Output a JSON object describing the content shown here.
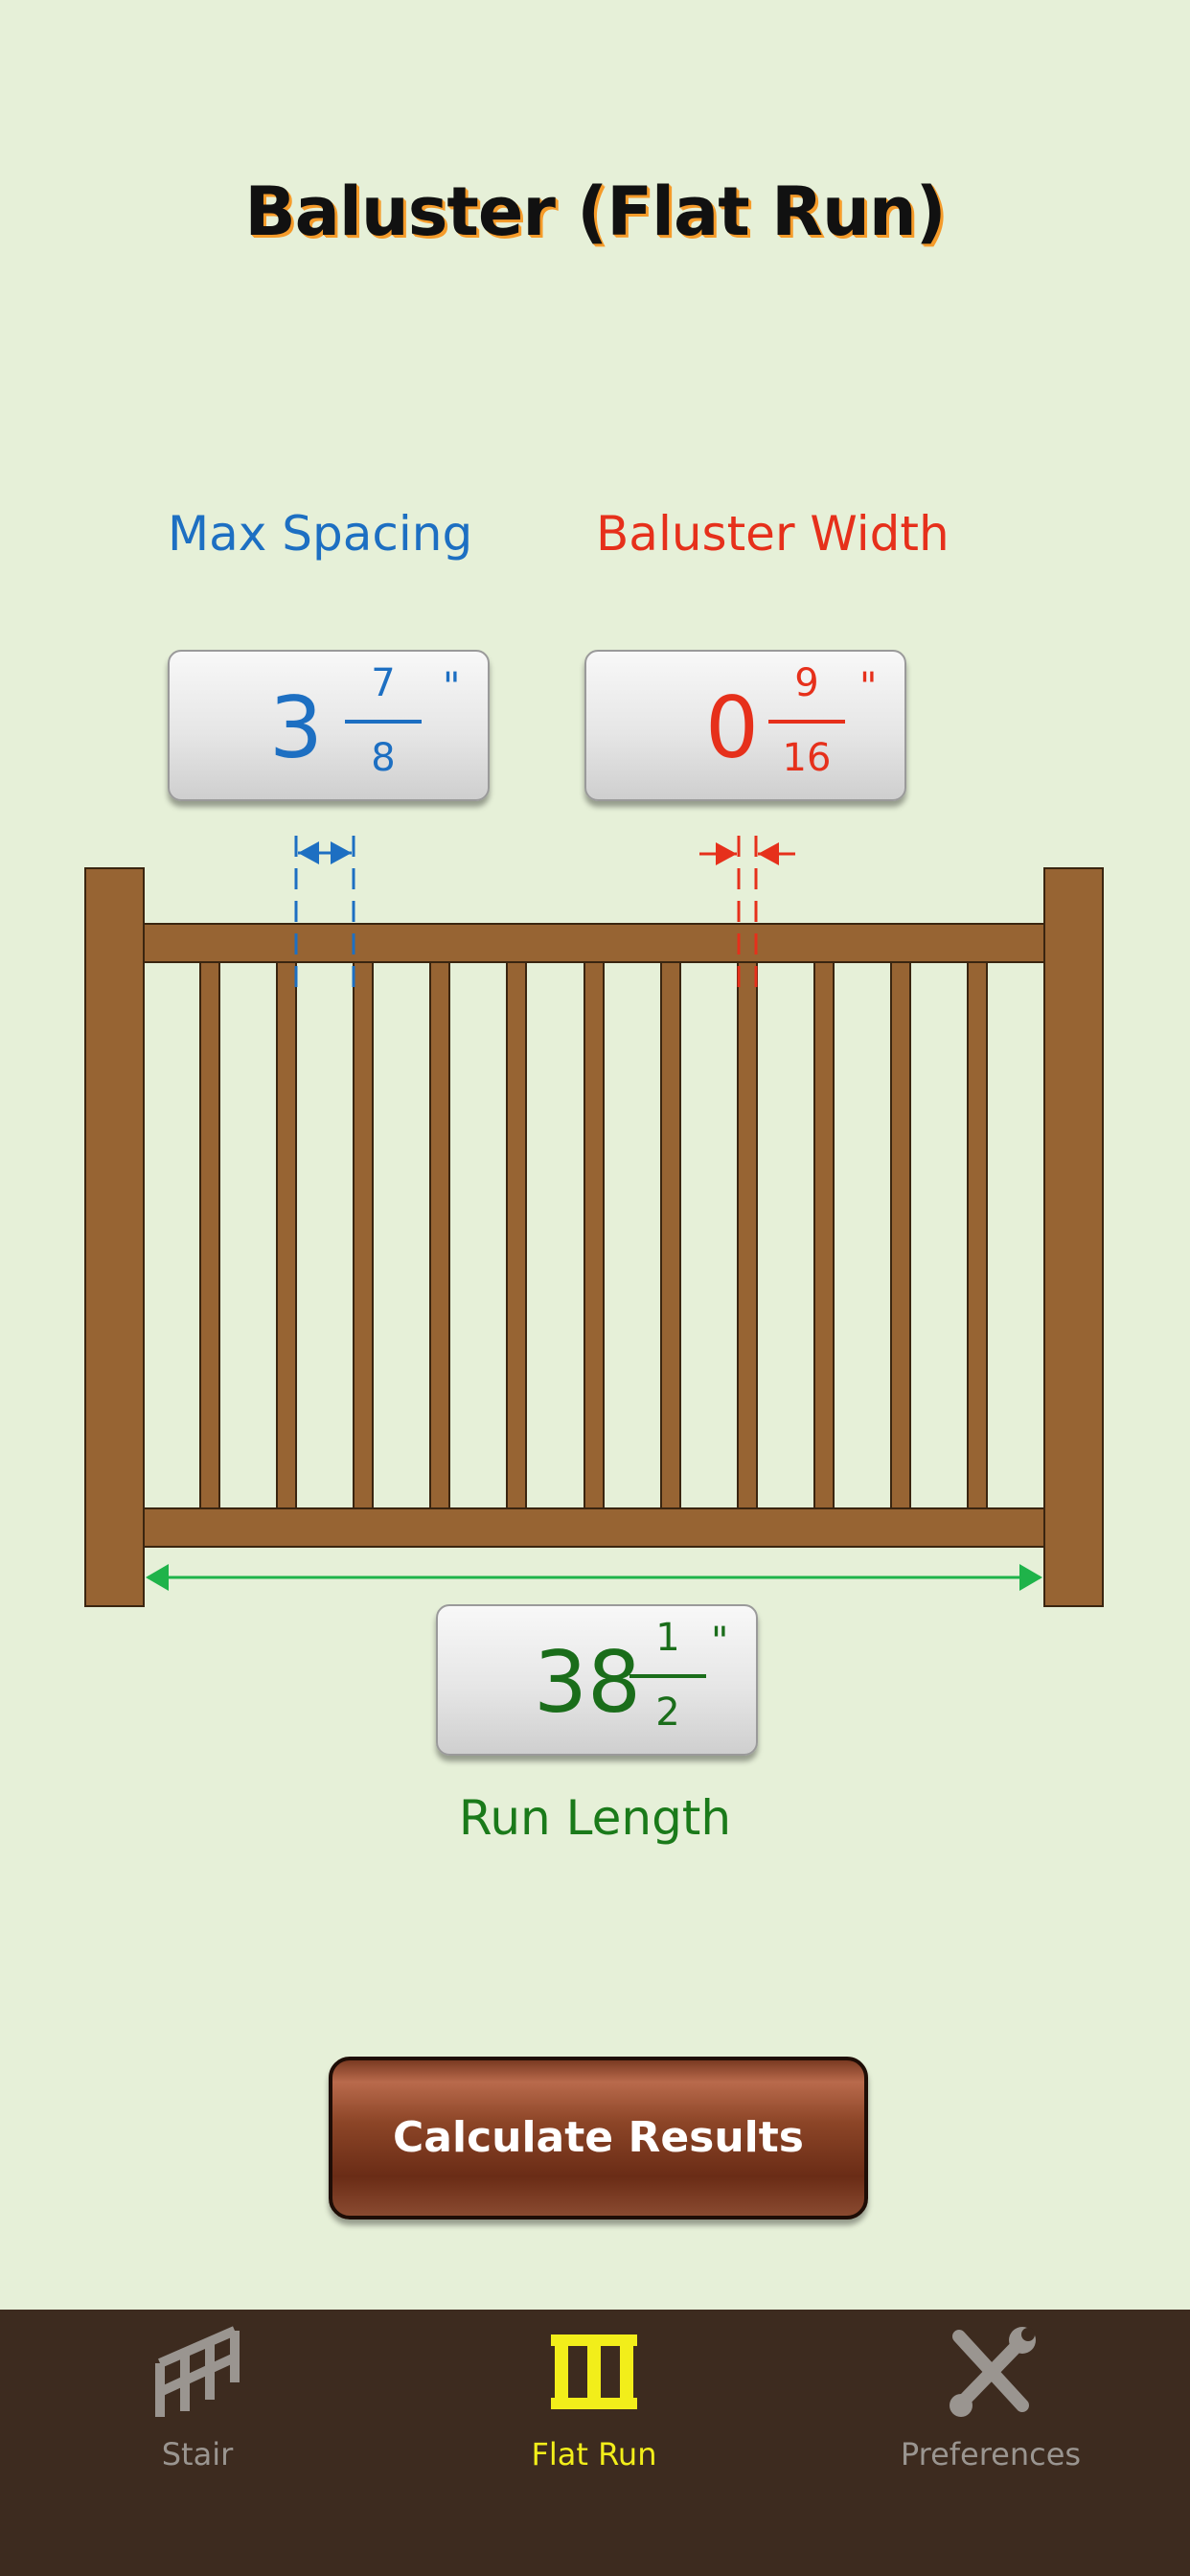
{
  "header": {
    "title": "Baluster (Flat Run)"
  },
  "inputs": {
    "max_spacing": {
      "label": "Max Spacing",
      "whole": "3",
      "numerator": "7",
      "denominator": "8",
      "unit": "\""
    },
    "baluster_width": {
      "label": "Baluster Width",
      "whole": "0",
      "numerator": "9",
      "denominator": "16",
      "unit": "\""
    },
    "run_length": {
      "label": "Run Length",
      "whole": "38",
      "numerator": "1",
      "denominator": "2",
      "unit": "\""
    }
  },
  "actions": {
    "calculate_label": "Calculate Results"
  },
  "tabbar": {
    "items": [
      {
        "label": "Stair",
        "icon": "stair-icon",
        "active": false
      },
      {
        "label": "Flat Run",
        "icon": "flat-run-icon",
        "active": true
      },
      {
        "label": "Preferences",
        "icon": "tools-icon",
        "active": false
      }
    ]
  },
  "colors": {
    "background": "#e6f0d8",
    "spacing": "#1d6fc2",
    "width": "#e6301b",
    "run": "#1a7a1a",
    "wood": "#976433",
    "tabbar": "#3d2b1f",
    "tab_active": "#f2ee1a",
    "tab_inactive": "#9a9590"
  }
}
